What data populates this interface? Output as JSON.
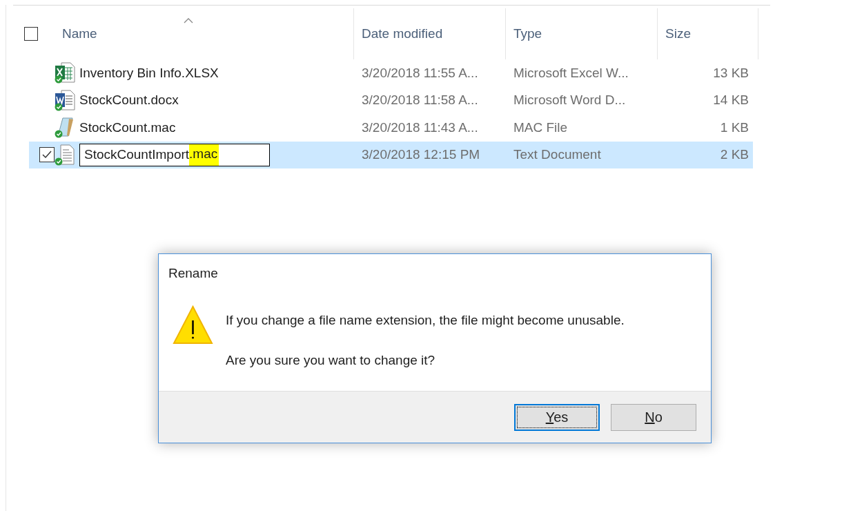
{
  "file_list": {
    "select_all_checked": false,
    "columns": [
      {
        "label": "Name",
        "sorted": true
      },
      {
        "label": "Date modified",
        "sorted": false
      },
      {
        "label": "Type",
        "sorted": false
      },
      {
        "label": "Size",
        "sorted": false
      }
    ],
    "rows": [
      {
        "kind": "excel",
        "name": "Inventory Bin Info.XLSX",
        "date": "3/20/2018 11:55 A...",
        "type": "Microsoft Excel W...",
        "size": "13 KB",
        "selected": false,
        "checked": false,
        "editing": false
      },
      {
        "kind": "word",
        "name": "StockCount.docx",
        "date": "3/20/2018 11:58 A...",
        "type": "Microsoft Word D...",
        "size": "14 KB",
        "selected": false,
        "checked": false,
        "editing": false
      },
      {
        "kind": "mac",
        "name": "StockCount.mac",
        "date": "3/20/2018 11:43 A...",
        "type": "MAC File",
        "size": "1 KB",
        "selected": false,
        "checked": false,
        "editing": false
      },
      {
        "kind": "text",
        "name": "StockCountImport.mac",
        "date": "3/20/2018 12:15 PM",
        "type": "Text Document",
        "size": "2 KB",
        "selected": true,
        "checked": true,
        "editing": true,
        "extension_highlighted": true
      }
    ]
  },
  "dialog": {
    "title": "Rename",
    "message": "If you change a file name extension, the file might become unusable.",
    "question": "Are you sure you want to change it?",
    "buttons": [
      {
        "label": "Yes",
        "default": true
      },
      {
        "label": "No",
        "default": false
      }
    ]
  }
}
